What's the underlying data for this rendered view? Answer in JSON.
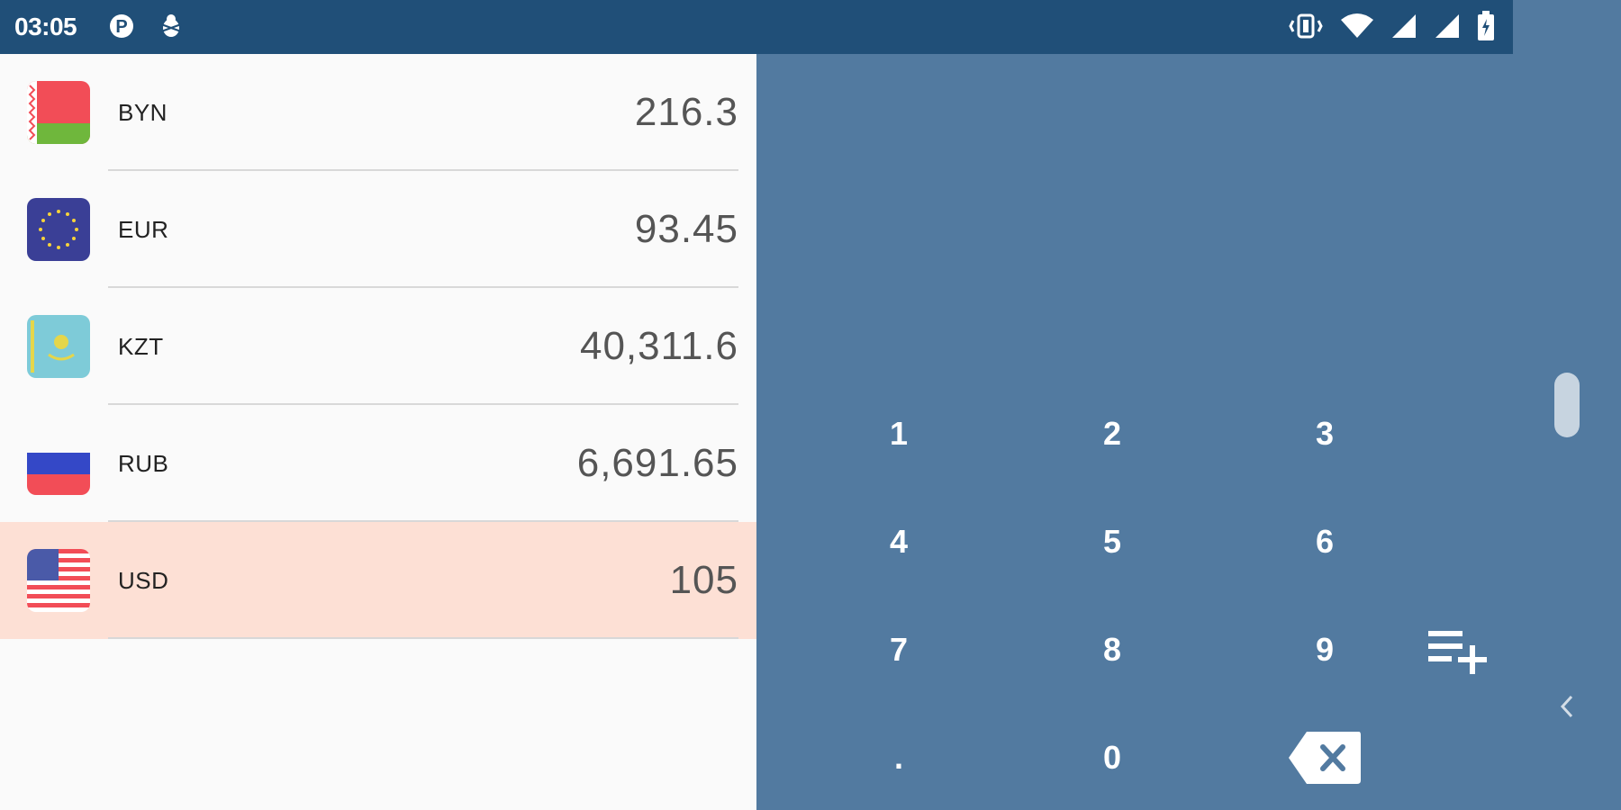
{
  "status_bar": {
    "time": "03:05",
    "left_icons": [
      "parking-app-icon",
      "bug-notification-icon"
    ],
    "right_icons": [
      "vibrate-icon",
      "wifi-icon",
      "signal-icon",
      "signal-icon",
      "battery-icon"
    ]
  },
  "currencies": [
    {
      "code": "BYN",
      "amount": "216.3",
      "flag": "belarus-flag-icon",
      "selected": false
    },
    {
      "code": "EUR",
      "amount": "93.45",
      "flag": "eu-flag-icon",
      "selected": false
    },
    {
      "code": "KZT",
      "amount": "40,311.6",
      "flag": "kazakhstan-flag-icon",
      "selected": false
    },
    {
      "code": "RUB",
      "amount": "6,691.65",
      "flag": "russia-flag-icon",
      "selected": false
    },
    {
      "code": "USD",
      "amount": "105",
      "flag": "usa-flag-icon",
      "selected": true
    }
  ],
  "keypad": {
    "keys": [
      "1",
      "2",
      "3",
      "4",
      "5",
      "6",
      "7",
      "8",
      "9",
      ".",
      "0"
    ],
    "backspace_icon": "backspace-icon",
    "add_currency_icon": "playlist-add-icon",
    "collapse_icon": "chevron-left-icon"
  },
  "colors": {
    "status_bar": "#204f78",
    "keypad_background": "#527aa0",
    "selected_row": "#fde0d5",
    "list_background": "#fafafa"
  }
}
